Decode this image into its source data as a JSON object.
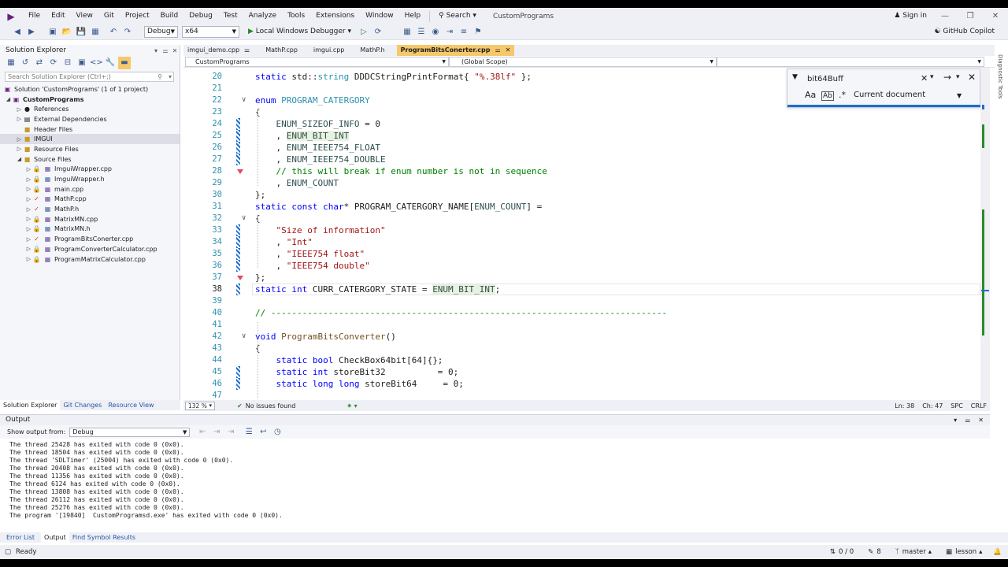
{
  "menubar": {
    "items": [
      "File",
      "Edit",
      "View",
      "Git",
      "Project",
      "Build",
      "Debug",
      "Test",
      "Analyze",
      "Tools",
      "Extensions",
      "Window",
      "Help"
    ],
    "search_label": "Search",
    "solution_name": "CustomPrograms",
    "sign_in": "Sign in"
  },
  "toolbar": {
    "config": "Debug",
    "platform": "x64",
    "run_label": "Local Windows Debugger",
    "copilot": "GitHub Copilot"
  },
  "solution_explorer": {
    "title": "Solution Explorer",
    "search_placeholder": "Search Solution Explorer (Ctrl+;)",
    "tree": [
      {
        "label": "Solution 'CustomPrograms' (1 of 1 project)"
      },
      {
        "label": "CustomPrograms"
      },
      {
        "label": "References"
      },
      {
        "label": "External Dependencies"
      },
      {
        "label": "Header Files"
      },
      {
        "label": "IMGUI"
      },
      {
        "label": "Resource Files"
      },
      {
        "label": "Source Files"
      },
      {
        "label": "ImguiWrapper.cpp"
      },
      {
        "label": "ImguiWrapper.h"
      },
      {
        "label": "main.cpp"
      },
      {
        "label": "MathP.cpp"
      },
      {
        "label": "MathP.h"
      },
      {
        "label": "MatrixMN.cpp"
      },
      {
        "label": "MatrixMN.h"
      },
      {
        "label": "ProgramBitsConerter.cpp"
      },
      {
        "label": "ProgramConverterCalculator.cpp"
      },
      {
        "label": "ProgramMatrixCalculator.cpp"
      }
    ],
    "bottom_tabs": [
      "Solution Explorer",
      "Git Changes",
      "Resource View"
    ]
  },
  "doc_tabs": [
    "imgui_demo.cpp",
    "MathP.cpp",
    "imgui.cpp",
    "MathP.h",
    "ProgramBitsConerter.cpp"
  ],
  "navbar": {
    "project": "CustomPrograms",
    "scope": "(Global Scope)"
  },
  "find": {
    "query": "bit64Buff",
    "scope": "Current document"
  },
  "code_lines": [
    {
      "n": "20",
      "html": "<span class=\"kw\">static</span> std::<span class=\"ty\">string</span> DDDCStringPrintFormat{ <span class=\"st\">\"%.38lf\"</span> };"
    },
    {
      "n": "21",
      "html": ""
    },
    {
      "n": "22",
      "html": "<span class=\"kw\">enum</span> <span class=\"ty\">PROGRAM_CATERGORY</span>"
    },
    {
      "n": "23",
      "html": "{"
    },
    {
      "n": "24",
      "html": "    <span class=\"en\">ENUM_SIZEOF_INFO</span> = 0"
    },
    {
      "n": "25",
      "html": "    , <span class=\"en hl\">ENUM_BIT_INT</span>"
    },
    {
      "n": "26",
      "html": "    , <span class=\"en\">ENUM_IEEE754_FLOAT</span>"
    },
    {
      "n": "27",
      "html": "    , <span class=\"en\">ENUM_IEEE754_DOUBLE</span>"
    },
    {
      "n": "28",
      "html": "    <span class=\"cm\">// this will break if enum number is not in sequence</span>"
    },
    {
      "n": "29",
      "html": "    , <span class=\"en\">ENUM_COUNT</span>"
    },
    {
      "n": "30",
      "html": "};"
    },
    {
      "n": "31",
      "html": "<span class=\"kw\">static const char</span>* PROGRAM_CATERGORY_NAME[<span class=\"en\">ENUM_COUNT</span>] ="
    },
    {
      "n": "32",
      "html": "{"
    },
    {
      "n": "33",
      "html": "    <span class=\"st\">\"Size of information\"</span>"
    },
    {
      "n": "34",
      "html": "    , <span class=\"st\">\"Int\"</span>"
    },
    {
      "n": "35",
      "html": "    , <span class=\"st\">\"IEEE754 float\"</span>"
    },
    {
      "n": "36",
      "html": "    , <span class=\"st\">\"IEEE754 double\"</span>"
    },
    {
      "n": "37",
      "html": "};"
    },
    {
      "n": "38",
      "html": "<span class=\"kw\">static int</span> CURR_CATERGORY_STATE = <span class=\"en hl\">ENUM_BIT_INT</span>;"
    },
    {
      "n": "39",
      "html": ""
    },
    {
      "n": "40",
      "html": "<span class=\"cm\">// ----------------------------------------------------------------------------</span>"
    },
    {
      "n": "41",
      "html": ""
    },
    {
      "n": "42",
      "html": "<span class=\"kw\">void</span> <span class=\"fn\">ProgramBitsConverter</span>()"
    },
    {
      "n": "43",
      "html": "{"
    },
    {
      "n": "44",
      "html": "    <span class=\"kw\">static bool</span> CheckBox64bit[64]{};"
    },
    {
      "n": "45",
      "html": "    <span class=\"kw\">static int</span> storeBit32          = 0;"
    },
    {
      "n": "46",
      "html": "    <span class=\"kw\">static long long</span> storeBit64     = 0;"
    },
    {
      "n": "47",
      "html": ""
    }
  ],
  "editor_status": {
    "zoom": "132 %",
    "issues": "No issues found",
    "ln": "Ln: 38",
    "ch": "Ch: 47",
    "spc": "SPC",
    "crlf": "CRLF"
  },
  "output": {
    "title": "Output",
    "show_from_label": "Show output from:",
    "show_from_value": "Debug",
    "lines": [
      "The thread 25428 has exited with code 0 (0x0).",
      "The thread 18504 has exited with code 0 (0x0).",
      "The thread 'SDLTimer' (25004) has exited with code 0 (0x0).",
      "The thread 20408 has exited with code 0 (0x0).",
      "The thread 11356 has exited with code 0 (0x0).",
      "The thread 6124 has exited with code 0 (0x0).",
      "The thread 13808 has exited with code 0 (0x0).",
      "The thread 26112 has exited with code 0 (0x0).",
      "The thread 25276 has exited with code 0 (0x0).",
      "The program '[19840]  CustomProgramsd.exe' has exited with code 0 (0x0)."
    ]
  },
  "output_tabs": [
    "Error List",
    "Output",
    "Find Symbol Results"
  ],
  "statusbar": {
    "ready": "Ready",
    "updown": "0 / 0",
    "pencil": "8",
    "branch": "master",
    "repo": "lesson"
  },
  "side_tab": "Diagnostic Tools"
}
